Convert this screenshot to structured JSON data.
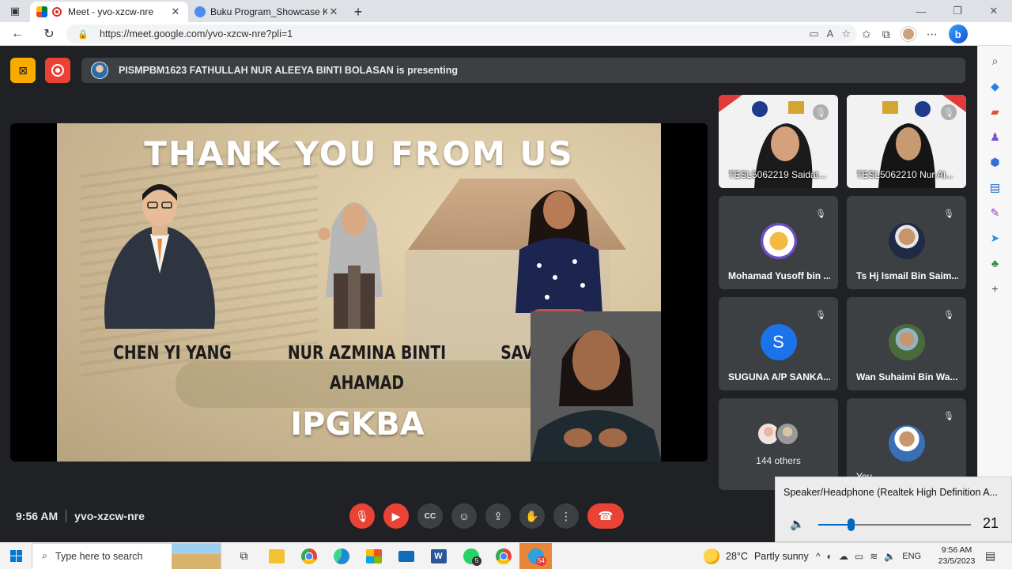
{
  "browser": {
    "tabs": [
      {
        "title": "Meet - yvo-xzcw-nre",
        "active": true
      },
      {
        "title": "Buku Program_Showcase KPPB D",
        "active": false
      }
    ],
    "url": "https://meet.google.com/yvo-xzcw-nre?pli=1"
  },
  "meet": {
    "presenting_text": "PISMPBM1623 FATHULLAH NUR ALEEYA BINTI BOLASAN is presenting",
    "slide": {
      "title": "THANK YOU FROM US",
      "names": [
        "CHEN YI YANG",
        "NUR AZMINA BINTI AHAMAD",
        "SAVITI MOG"
      ],
      "footer": "IPGKBA"
    },
    "participants": [
      {
        "name": "TESL5062219 Saidat...",
        "type": "video"
      },
      {
        "name": "TESL5062210 Nur Ai...",
        "type": "video"
      },
      {
        "name": "Mohamad Yusoff bin ...",
        "type": "avatar"
      },
      {
        "name": "Ts Hj Ismail Bin Saim...",
        "type": "avatar"
      },
      {
        "name": "SUGUNA A/P SANKA...",
        "type": "letter",
        "letter": "S"
      },
      {
        "name": "Wan Suhaimi Bin Wa...",
        "type": "avatar"
      },
      {
        "name": "144 others",
        "type": "others"
      },
      {
        "name": "You",
        "type": "avatar"
      }
    ],
    "time": "9:56 AM",
    "meeting_code": "yvo-xzcw-nre"
  },
  "volume": {
    "device": "Speaker/Headphone (Realtek High Definition A...",
    "level": 21
  },
  "taskbar": {
    "search_placeholder": "Type here to search",
    "whatsapp_badge": "5",
    "chrome_badge": "54",
    "weather": {
      "temp": "28°C",
      "condition": "Partly sunny"
    },
    "language": "ENG",
    "time": "9:56 AM",
    "date": "23/5/2023"
  },
  "colors": {
    "meet_bg": "#202124",
    "tile_bg": "#3c4043",
    "danger": "#ea4335",
    "warning": "#f9ab00",
    "accent": "#1a73e8"
  }
}
